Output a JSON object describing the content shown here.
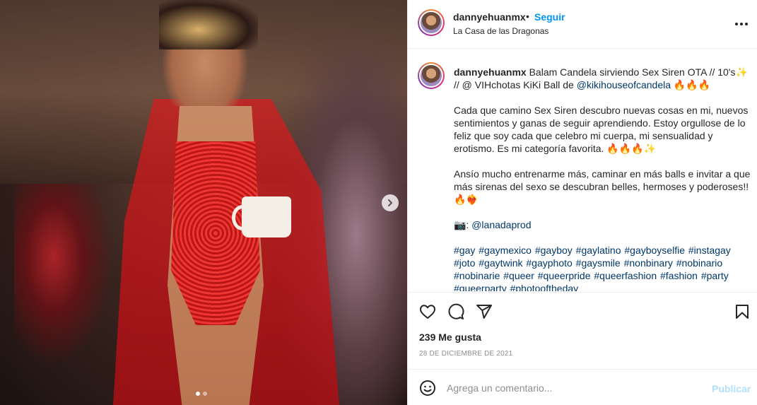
{
  "post": {
    "username": "dannyehuanmx",
    "separator": "•",
    "follow_label": "Seguir",
    "location": "La Casa de las Dragonas",
    "caption": {
      "username": "dannyehuanmx",
      "line1": "Balam Candela sirviendo Sex Siren OTA // 10's✨ // @ VIHchotas KiKi Ball de ",
      "mention": "@kikihouseofcandela",
      "line1_end": " 🔥🔥🔥",
      "para2": "Cada que camino Sex Siren descubro nuevas cosas en mi, nuevos sentimientos y ganas de seguir aprendiendo. Estoy orgullose de lo feliz que soy cada que celebro mi cuerpa, mi sensualidad y erotismo. Es mi categoría favorita. 🔥🔥🔥✨",
      "para3": "Ansío mucho entrenarme más, caminar en más balls e invitar a que más sirenas del sexo se descubran belles, hermoses y poderoses!! 🔥❤️‍🔥",
      "photo_credit_prefix": "📷: ",
      "photo_credit": "@lanadaprod",
      "hashtags": "#gay #gaymexico #gayboy #gaylatino #gayboyselfie #instagay #joto #gaytwink #gayphoto #gaysmile #nonbinary #nobinario #nobinarie #queer #queerpride #queerfashion #fashion #party #queerparty #photooftheday"
    },
    "likes": "239 Me gusta",
    "date": "28 DE DICIEMBRE DE 2021",
    "comment_placeholder": "Agrega un comentario...",
    "publish_label": "Publicar"
  },
  "icons": {
    "like": "heart-icon",
    "comment": "comment-icon",
    "share": "share-icon",
    "save": "bookmark-icon",
    "more": "more-icon",
    "emoji": "emoji-icon",
    "next": "chevron-right-icon"
  },
  "colors": {
    "link": "#0095f6",
    "tag": "#00376b",
    "publish_disabled": "#b2dffc"
  },
  "carousel": {
    "current": 1,
    "total": 2
  }
}
